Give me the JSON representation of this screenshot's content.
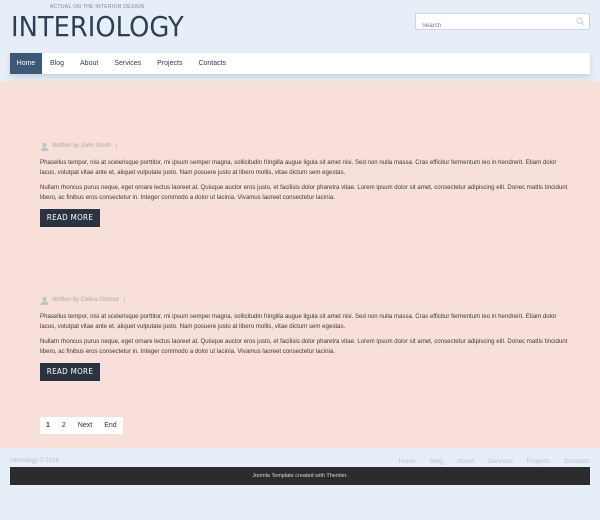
{
  "header": {
    "slogan": "ACTUAL ON THE INTERIOR DESIGN",
    "logo": "INTERIOLOGY"
  },
  "search": {
    "placeholder": "Search",
    "icon": "search-icon"
  },
  "nav": {
    "items": [
      "Home",
      "Blog",
      "About",
      "Services",
      "Projects",
      "Contacts"
    ],
    "active": "Home"
  },
  "articles": [
    {
      "author": "Written by John Smith",
      "para1": "Phasellus tempor, nisi at scelerisque porttitor, mi ipsum semper magna, sollicitudin fringilla augue ligula sit amet nisi. Sed non nulla massa. Cras efficitur fermentum leo in hendrerit. Etiam dolor lacus, volutpat vitae ante et, aliquet vulputate justo. Nam posuere justo at libero mollis, vitae dictum sem egestas.",
      "para2": "Nullam rhoncus purus neque, eget ornare lectus laoreet at. Quisque auctor eros justo, et facilisis dolor pharetra vitae. Lorem ipsum dolor sit amet, consectetur adipiscing elit. Donec mattis tincidunt libero, ac finibus eros consectetur in. Integer commodo a dolor ut lacinia. Vivamus laoreet consectetur lacinia.",
      "read_more": "READ MORE"
    },
    {
      "author": "Written by Celina Gomez",
      "para1": "Phasellus tempor, nisi at scelerisque porttitor, mi ipsum semper magna, sollicitudin fringilla augue ligula sit amet nisi. Sed non nulla massa. Cras efficitur fermentum leo in hendrerit. Etiam dolor lacus, volutpat vitae ante et, aliquet vulputate justo. Nam posuere justo at libero mollis, vitae dictum sem egestas.",
      "para2": "Nullam rhoncus purus neque, eget ornare lectus laoreet at. Quisque auctor eros justo, et facilisis dolor pharetra vitae. Lorem ipsum dolor sit amet, consectetur adipiscing elit. Donec mattis tincidunt libero, ac finibus eros consectetur in. Integer commodo a dolor ut lacinia. Vivamus laoreet consectetur lacinia.",
      "read_more": "READ MORE"
    }
  ],
  "pagination": {
    "items": [
      "1",
      "2",
      "Next",
      "End"
    ],
    "current": "1"
  },
  "footer": {
    "copyright": "Interiology © 2016",
    "nav": [
      "Home",
      "Blog",
      "About",
      "Services",
      "Projects",
      "Contacts"
    ],
    "credit": "Joomla Template created with Themler."
  },
  "colors": {
    "page_bg": "#e6eef7",
    "content_bg": "#f9dfd9",
    "nav_active": "#3d5878",
    "button": "#2b3342",
    "footer_bar": "#2c2c2c"
  }
}
